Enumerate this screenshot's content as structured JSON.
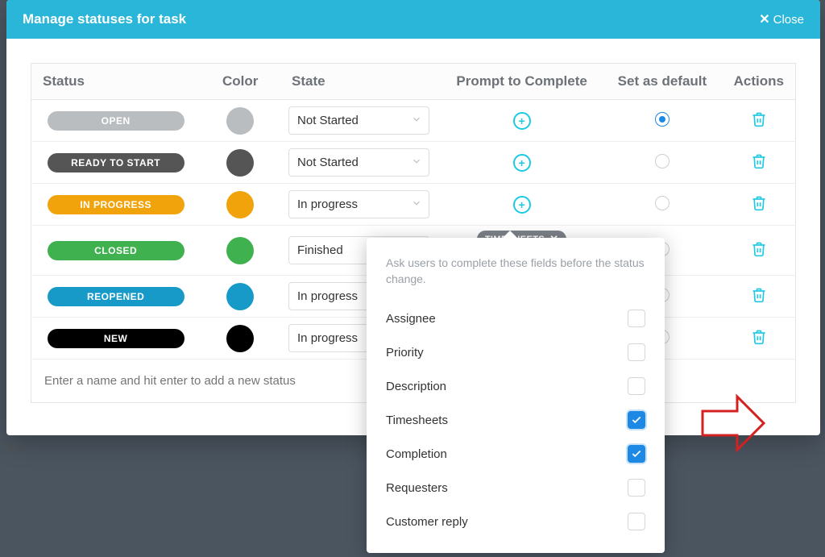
{
  "modal": {
    "title": "Manage statuses for task",
    "close_label": "Close"
  },
  "columns": {
    "status": "Status",
    "color": "Color",
    "state": "State",
    "prompt": "Prompt to Complete",
    "default": "Set as default",
    "actions": "Actions"
  },
  "rows": [
    {
      "name": "OPEN",
      "pill_color": "#b9bdc0",
      "swatch": "#b9bdc0",
      "state": "Not Started",
      "show_chevron": true,
      "default": true
    },
    {
      "name": "READY TO START",
      "pill_color": "#555555",
      "swatch": "#555555",
      "state": "Not Started",
      "show_chevron": true,
      "default": false
    },
    {
      "name": "IN PROGRESS",
      "pill_color": "#f0a30a",
      "swatch": "#f0a30a",
      "state": "In progress",
      "show_chevron": true,
      "default": false
    },
    {
      "name": "CLOSED",
      "pill_color": "#3fb24f",
      "swatch": "#3fb24f",
      "state": "Finished",
      "show_chevron": false,
      "default": false
    },
    {
      "name": "REOPENED",
      "pill_color": "#179ac8",
      "swatch": "#179ac8",
      "state": "In progress",
      "show_chevron": false,
      "default": false
    },
    {
      "name": "NEW",
      "pill_color": "#000000",
      "swatch": "#000000",
      "state": "In progress",
      "show_chevron": false,
      "default": false
    }
  ],
  "add_placeholder": "Enter a name and hit enter to add a new status",
  "chip": {
    "label": "TIMESHEETS"
  },
  "popover": {
    "title": "Ask users to complete these fields before the status change.",
    "fields": [
      {
        "label": "Assignee",
        "checked": false
      },
      {
        "label": "Priority",
        "checked": false
      },
      {
        "label": "Description",
        "checked": false
      },
      {
        "label": "Timesheets",
        "checked": true
      },
      {
        "label": "Completion",
        "checked": true
      },
      {
        "label": "Requesters",
        "checked": false
      },
      {
        "label": "Customer reply",
        "checked": false
      }
    ]
  },
  "bg_fragment": "atus"
}
